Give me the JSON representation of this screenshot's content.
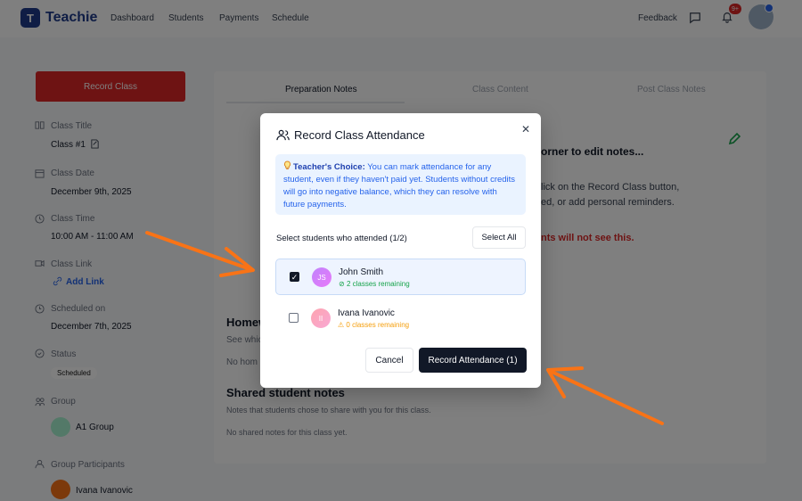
{
  "topnav": {
    "logo_letter": "T",
    "brand": "Teachie",
    "links": [
      "Dashboard",
      "Students",
      "Payments",
      "Schedule"
    ],
    "feedback": "Feedback",
    "notification_count": "9+"
  },
  "sidebar": {
    "record_button": "Record Class",
    "class_title_label": "Class Title",
    "class_title_value": "Class #1",
    "class_date_label": "Class Date",
    "class_date_value": "December 9th, 2025",
    "class_time_label": "Class Time",
    "class_time_value": "10:00 AM - 11:00 AM",
    "class_link_label": "Class Link",
    "class_link_value": "Add Link",
    "scheduled_label": "Scheduled on",
    "scheduled_value": "December 7th, 2025",
    "status_label": "Status",
    "status_value": "Scheduled",
    "group_label": "Group",
    "group_value": "A1 Group",
    "participants_label": "Group Participants",
    "participant_name": "Ivana Ivanovic"
  },
  "main": {
    "tabs": [
      "Preparation Notes",
      "Class Content",
      "Post Class Notes"
    ],
    "edit_hint": "orner to edit notes...",
    "desc_line1": "lick on the Record Class button,",
    "desc_line2": "ed, or add personal reminders.",
    "warning": "nts will not see this.",
    "homework_heading": "Homew",
    "homework_sub": "See whic",
    "homework_empty": "No hom",
    "shared_heading": "Shared student notes",
    "shared_sub": "Notes that students chose to share with you for this class.",
    "shared_empty": "No shared notes for this class yet."
  },
  "modal": {
    "title": "Record Class Attendance",
    "info_bold": "Teacher's Choice:",
    "info_text": " You can mark attendance for any student, even if they haven't paid yet. Students without credits will go into negative balance, which they can resolve with future payments.",
    "select_label": "Select students who attended (1/2)",
    "select_all": "Select All",
    "students": [
      {
        "initials": "JS",
        "name": "John Smith",
        "sub": "2 classes remaining",
        "checked": true
      },
      {
        "initials": "II",
        "name": "Ivana Ivanovic",
        "sub": "0 classes remaining",
        "checked": false
      }
    ],
    "cancel": "Cancel",
    "record_attendance": "Record Attendance (1)"
  },
  "colors": {
    "accent_dark": "#111827",
    "brand_blue": "#1e3a8a",
    "record_red": "#dc2626",
    "success_green": "#16a34a",
    "warning_orange": "#f59e0b",
    "arrow_orange": "#f97316"
  }
}
